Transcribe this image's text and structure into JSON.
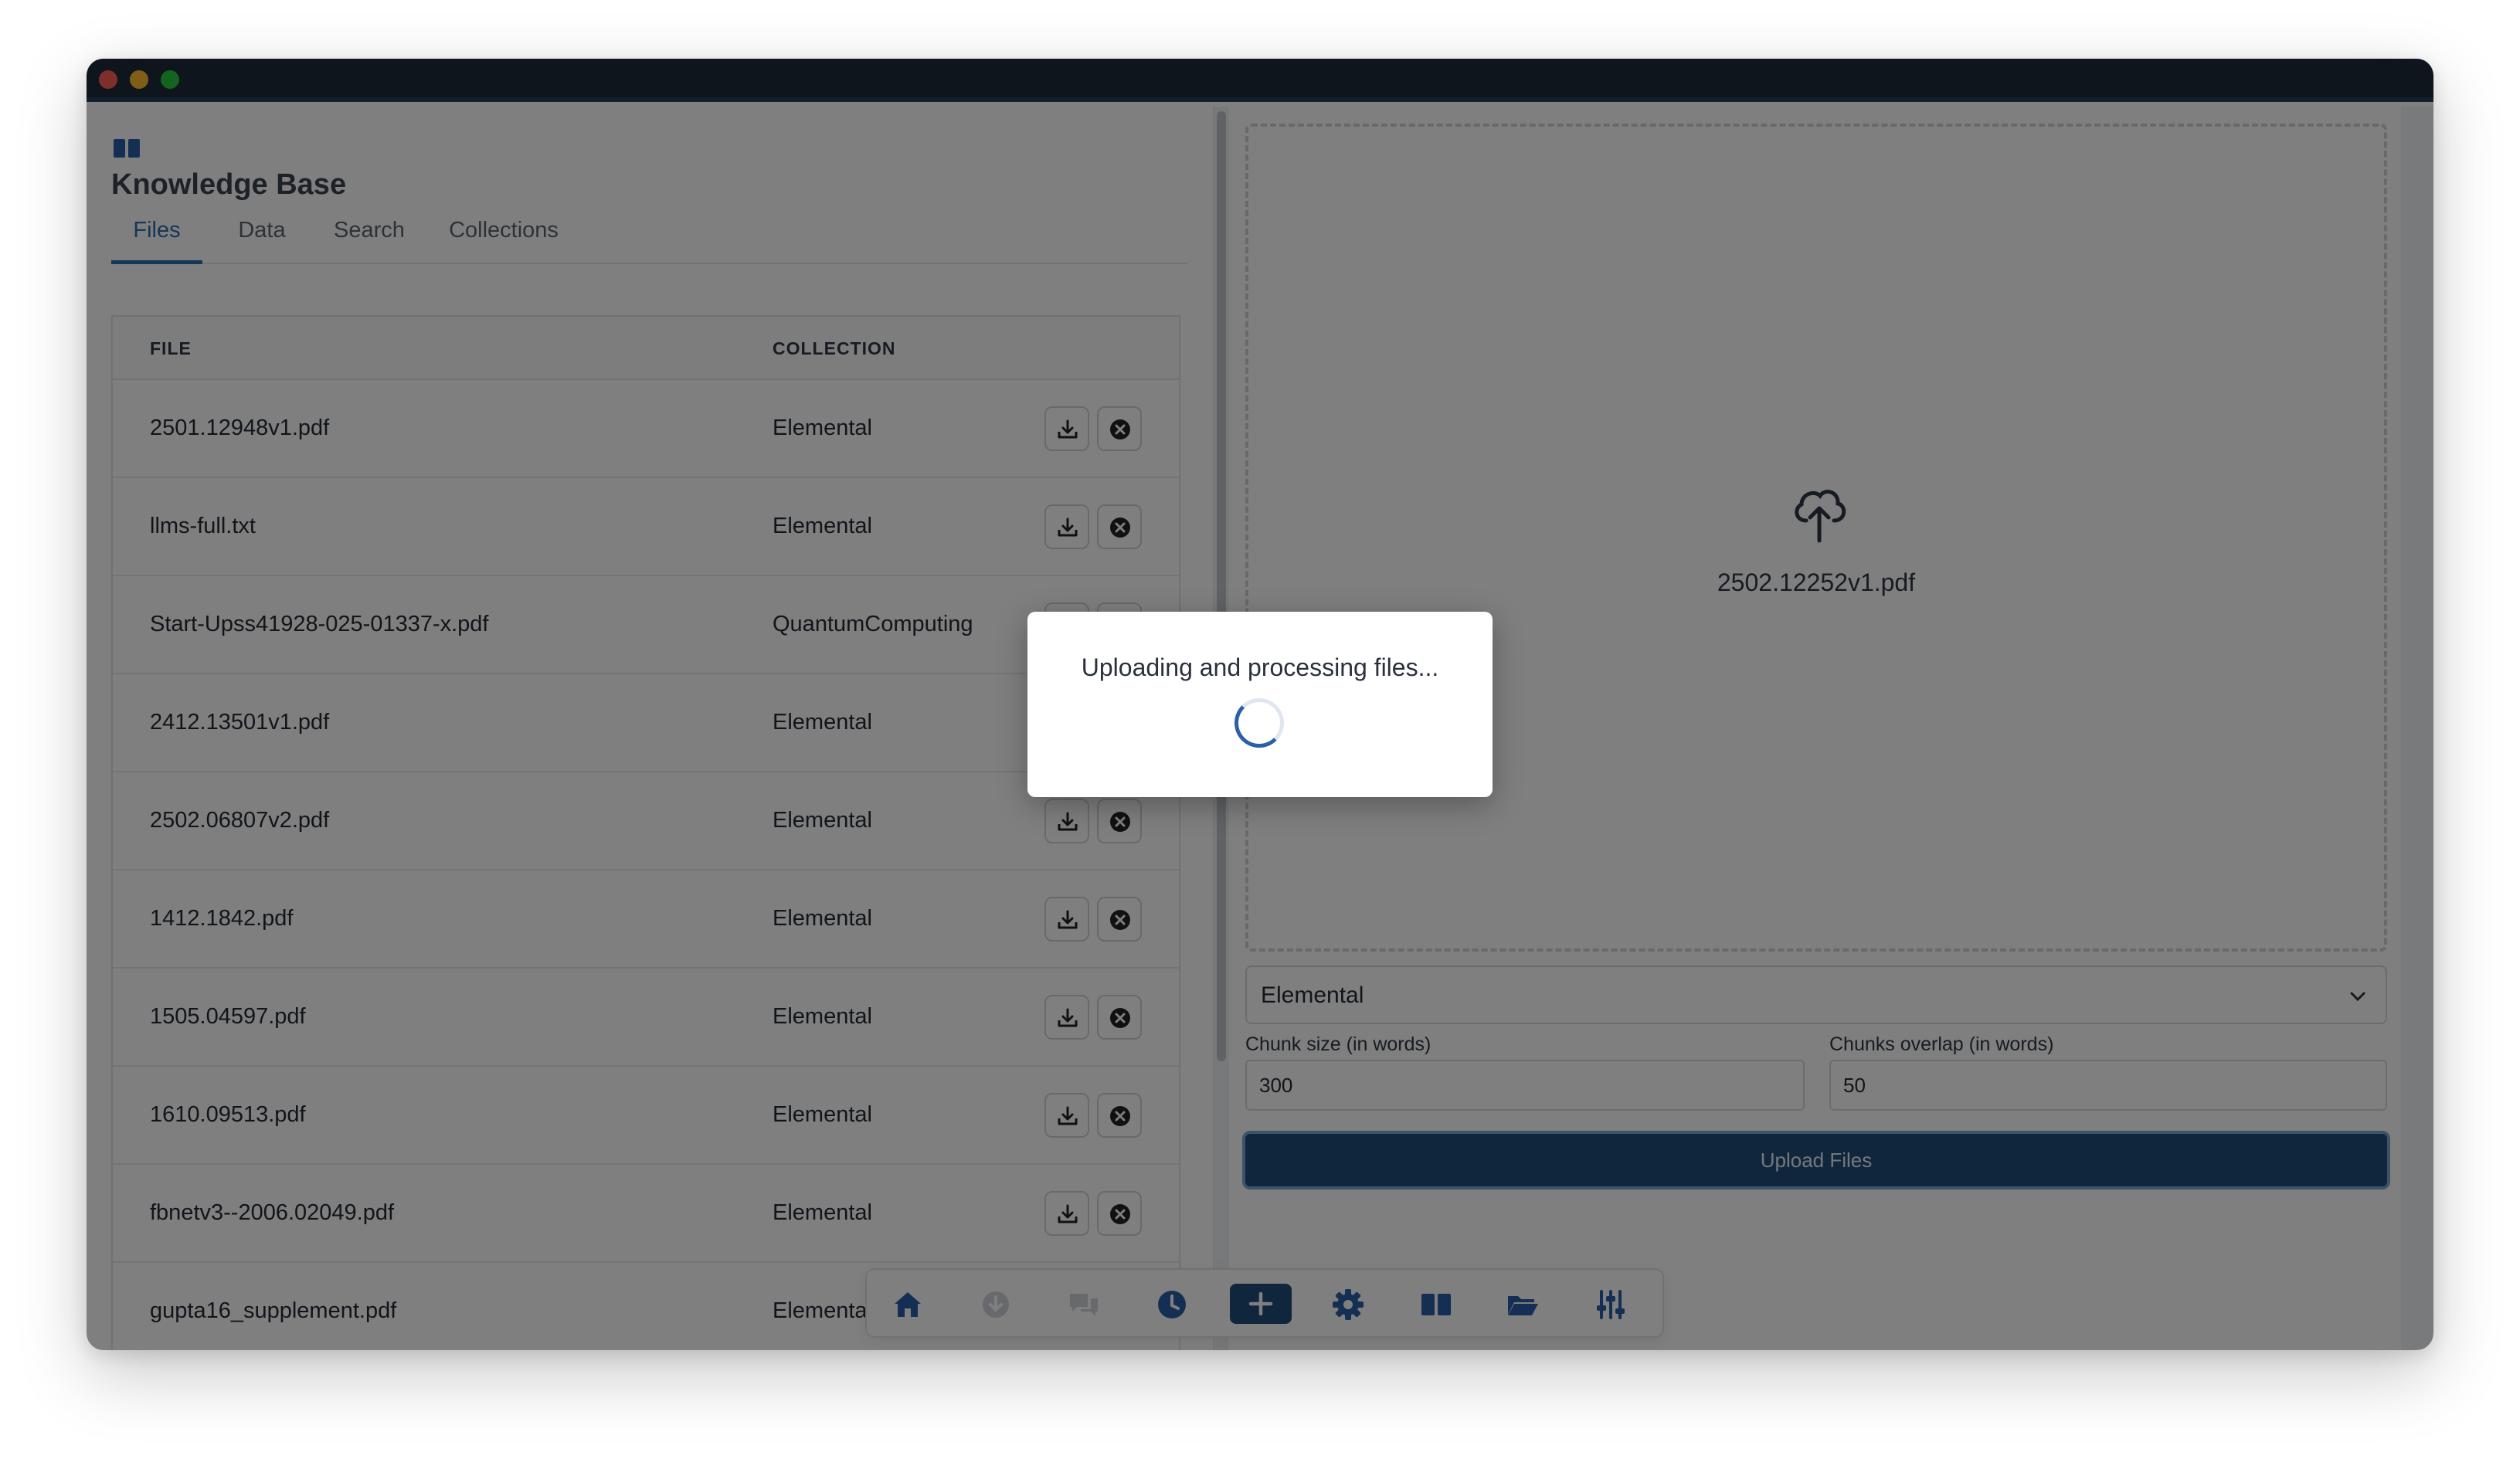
{
  "window": {
    "traffic_lights": [
      "close",
      "minimize",
      "zoom"
    ]
  },
  "header": {
    "icon": "book-icon",
    "title": "Knowledge Base"
  },
  "tabs": [
    {
      "label": "Files",
      "active": true
    },
    {
      "label": "Data",
      "active": false
    },
    {
      "label": "Search",
      "active": false
    },
    {
      "label": "Collections",
      "active": false
    }
  ],
  "table": {
    "columns": [
      "FILE",
      "COLLECTION"
    ],
    "rows": [
      {
        "file": "2501.12948v1.pdf",
        "collection": "Elemental"
      },
      {
        "file": "llms-full.txt",
        "collection": "Elemental"
      },
      {
        "file": "Start-Upss41928-025-01337-x.pdf",
        "collection": "QuantumComputing"
      },
      {
        "file": "2412.13501v1.pdf",
        "collection": "Elemental"
      },
      {
        "file": "2502.06807v2.pdf",
        "collection": "Elemental"
      },
      {
        "file": "1412.1842.pdf",
        "collection": "Elemental"
      },
      {
        "file": "1505.04597.pdf",
        "collection": "Elemental"
      },
      {
        "file": "1610.09513.pdf",
        "collection": "Elemental"
      },
      {
        "file": "fbnetv3--2006.02049.pdf",
        "collection": "Elemental"
      },
      {
        "file": "gupta16_supplement.pdf",
        "collection": "Elemental"
      }
    ]
  },
  "upload": {
    "dropzone_icon": "cloud-upload-icon",
    "selected_file": "2502.12252v1.pdf",
    "collection_selected": "Elemental",
    "chunk_size_label": "Chunk size (in words)",
    "chunk_size_value": "300",
    "chunk_overlap_label": "Chunks overlap (in words)",
    "chunk_overlap_value": "50",
    "button_label": "Upload Files"
  },
  "dock": {
    "items": [
      "home-icon",
      "download-icon",
      "chat-icon",
      "history-icon",
      "plus-icon",
      "gear-icon",
      "book-icon",
      "folder-icon",
      "sliders-icon"
    ]
  },
  "modal": {
    "message": "Uploading and processing files..."
  },
  "colors": {
    "accent": "#2b6cb0",
    "primary_button": "#1f4d7a",
    "titlebar": "#1c2a38"
  }
}
